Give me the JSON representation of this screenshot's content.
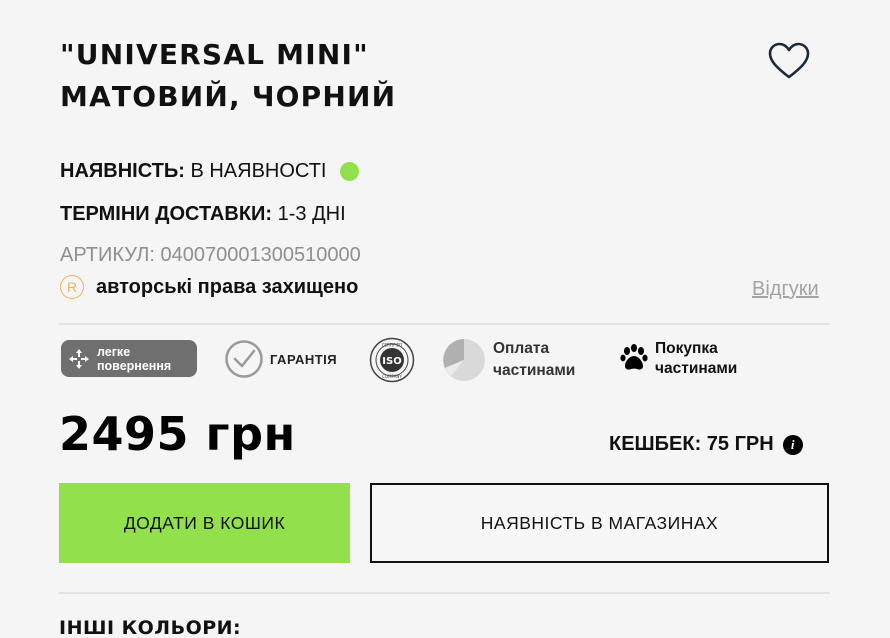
{
  "product": {
    "title_line1": "\"UNIVERSAL MINI\"",
    "title_line2": "МАТОВИЙ, ЧОРНИЙ"
  },
  "availability": {
    "label": "НАЯВНІСТЬ:",
    "value": "В НАЯВНОСТІ",
    "status_color": "#93e04d"
  },
  "delivery": {
    "label": "ТЕРМІНИ ДОСТАВКИ:",
    "value": "1-3 ДНІ"
  },
  "article": {
    "text": "АРТИКУЛ: 040070001300510000"
  },
  "copyright": {
    "icon_glyph": "R",
    "text": "авторські права захищено"
  },
  "reviews_link": "Відгуки",
  "badges": {
    "return_line1": "легке",
    "return_line2": "повернення",
    "warranty": "ГАРАНТІЯ",
    "parts_line1": "Оплата",
    "parts_line2": "частинами",
    "paw_line1": "Покупка",
    "paw_line2": "частинами"
  },
  "price": "2495 грн",
  "cashback": {
    "text": "КЕШБЕК: 75 ГРН",
    "info_glyph": "i"
  },
  "buttons": {
    "add_to_cart": "ДОДАТИ В КОШИК",
    "store_availability": "НАЯВНІСТЬ В МАГАЗИНАХ"
  },
  "other_colors_heading": "ІНШІ КОЛЬОРИ:",
  "colors": {
    "accent": "#93e04d",
    "background": "#f5f5f6",
    "copyright_icon": "#f0b45a"
  },
  "icons": [
    "heart-icon",
    "return-arrows-icon",
    "check-circle-icon",
    "iso-certified-icon",
    "pie-chart-icon",
    "paw-icon",
    "info-icon"
  ]
}
